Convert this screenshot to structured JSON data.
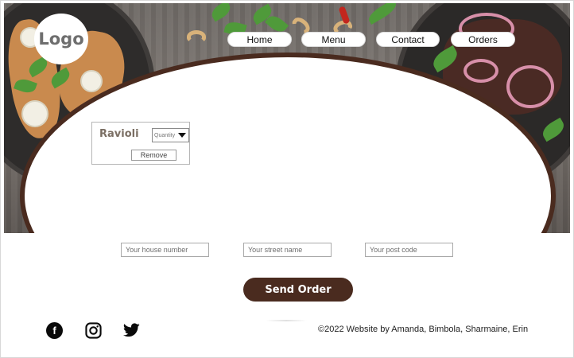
{
  "brand": {
    "logo_text": "Logo"
  },
  "nav": {
    "items": [
      {
        "label": "Home"
      },
      {
        "label": "Menu"
      },
      {
        "label": "Contact"
      },
      {
        "label": "Orders"
      }
    ]
  },
  "cart": {
    "item_name": "Ravioli",
    "quantity_label": "Quantity",
    "remove_label": "Remove"
  },
  "address": {
    "house_placeholder": "Your house number",
    "street_placeholder": "Your street name",
    "postcode_placeholder": "Your post code"
  },
  "actions": {
    "send_label": "Send Order"
  },
  "footer": {
    "social": [
      {
        "icon": "facebook-icon",
        "glyph": "f"
      },
      {
        "icon": "instagram-icon"
      },
      {
        "icon": "twitter-icon"
      }
    ],
    "copyright": "©2022 Website by Amanda, Bimbola, Sharmaine, Erin"
  },
  "colors": {
    "accent_brown": "#4a2b1f",
    "text_dark": "#111111",
    "item_text": "#7b6f64"
  }
}
